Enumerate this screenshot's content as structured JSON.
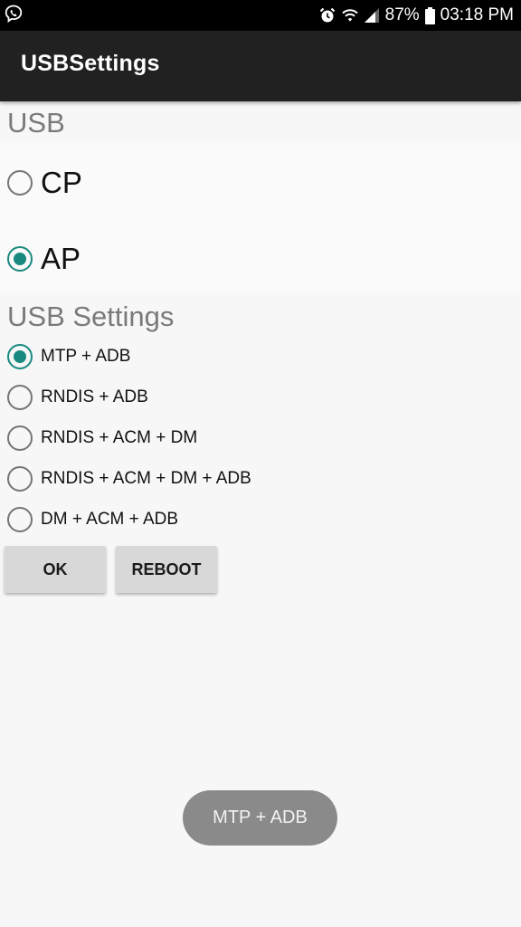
{
  "status_bar": {
    "battery": "87%",
    "time": "03:18 PM",
    "icons": [
      "viber-icon",
      "alarm-icon",
      "wifi-icon",
      "signal-icon",
      "battery-icon"
    ]
  },
  "app_bar": {
    "title": "USBSettings"
  },
  "usb_section": {
    "title": "USB",
    "options": [
      {
        "label": "CP",
        "checked": false
      },
      {
        "label": "AP",
        "checked": true
      }
    ]
  },
  "usb_settings_section": {
    "title": "USB Settings",
    "options": [
      {
        "label": "MTP + ADB",
        "checked": true
      },
      {
        "label": "RNDIS + ADB",
        "checked": false
      },
      {
        "label": "RNDIS + ACM + DM",
        "checked": false
      },
      {
        "label": "RNDIS + ACM + DM + ADB",
        "checked": false
      },
      {
        "label": "DM + ACM + ADB",
        "checked": false
      }
    ]
  },
  "buttons": {
    "ok": "OK",
    "reboot": "REBOOT"
  },
  "toast": {
    "text": "MTP + ADB"
  },
  "colors": {
    "accent": "#1a8a80",
    "app_bar": "#212121",
    "status_bar": "#000000"
  }
}
